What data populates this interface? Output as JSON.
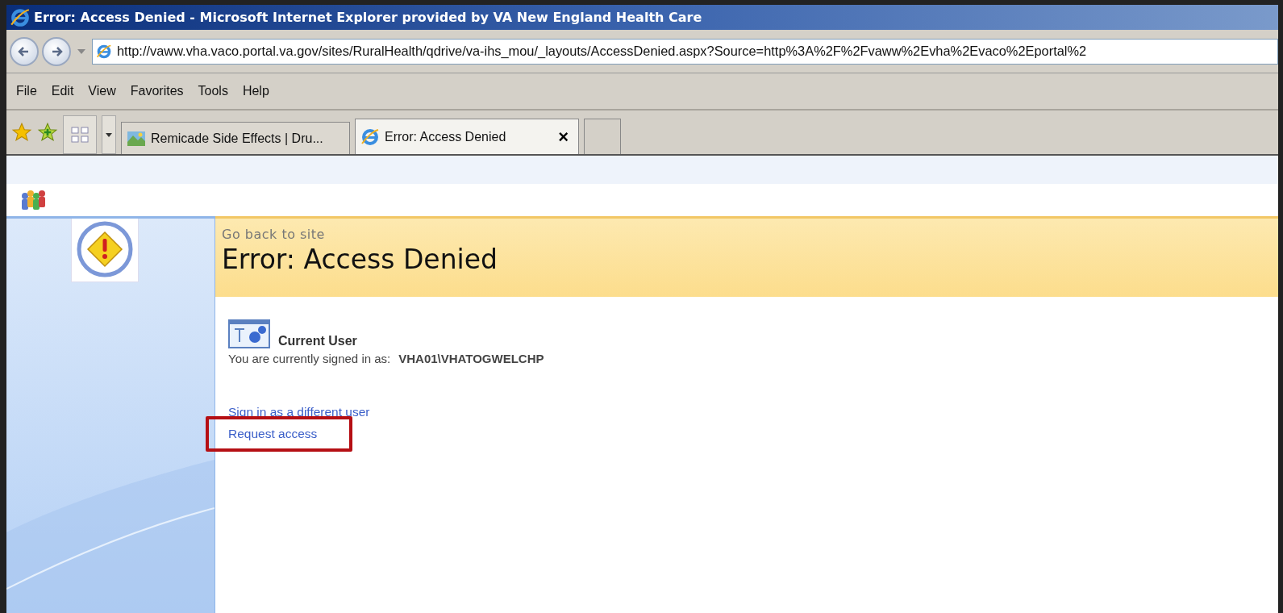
{
  "window": {
    "title": "Error: Access Denied - Microsoft Internet Explorer provided by VA New England Health Care"
  },
  "address_bar": {
    "value": "http://vaww.vha.vaco.portal.va.gov/sites/RuralHealth/qdrive/va-ihs_mou/_layouts/AccessDenied.aspx?Source=http%3A%2F%2Fvaww%2Evha%2Evaco%2Eportal%2"
  },
  "menu": [
    "File",
    "Edit",
    "View",
    "Favorites",
    "Tools",
    "Help"
  ],
  "tabs": [
    {
      "label": "Remicade Side Effects | Dru...",
      "selected": false
    },
    {
      "label": "Error: Access Denied",
      "selected": true
    }
  ],
  "tab_close": "×",
  "page": {
    "back_link": "Go back to site",
    "heading": "Error: Access Denied",
    "section_title": "Current User",
    "signed_in_label": "You are currently signed in as:",
    "user": "VHA01\\VHATOGWELCHP",
    "links": [
      {
        "label": "Sign in as a different user",
        "highlighted": false
      },
      {
        "label": "Request access",
        "highlighted": true
      }
    ]
  }
}
